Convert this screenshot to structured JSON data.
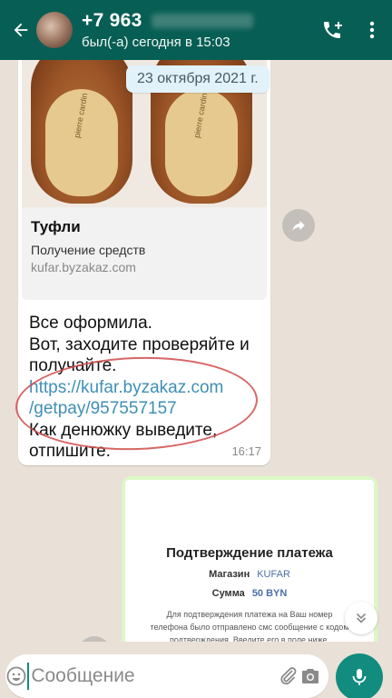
{
  "header": {
    "contact": "+7 963",
    "status": "был(-а) сегодня в 15:03",
    "icons": [
      "arrow-back-icon",
      "add-call-icon",
      "more-vert-icon"
    ]
  },
  "chat": {
    "date_chip": "23 октября 2021 г.",
    "link_preview": {
      "title": "Туфли",
      "description": "Получение средств",
      "domain": "kufar.byzakaz.com",
      "brand_text": "pierre cardin"
    },
    "message": {
      "line1": "Все оформила.",
      "line2": "Вот, заходите проверяйте и",
      "line3": "получайте.",
      "link1": "https://kufar.byzakaz.com",
      "link2": "/getpay/957557157",
      "line4": "Как денюжку выведите,",
      "line5": "отпишите.",
      "time": "16:17"
    },
    "outgoing_doc": {
      "title": "Подтверждение платежа",
      "shop_label": "Магазин",
      "shop_value": "KUFAR",
      "sum_label": "Сумма",
      "sum_value": "50 BYN",
      "note": "Для подтверждения платежа на Ваш номер телефона было отправлено смс сообщение с кодом подтверждения. Введите его в поле ниже."
    }
  },
  "input": {
    "placeholder": "Сообщение"
  },
  "colors": {
    "header_bg": "#075e54",
    "accent": "#128c7e",
    "outgoing_bubble": "#dcf8c6",
    "link": "#3f8fb5",
    "annotation": "#d14b4b"
  }
}
